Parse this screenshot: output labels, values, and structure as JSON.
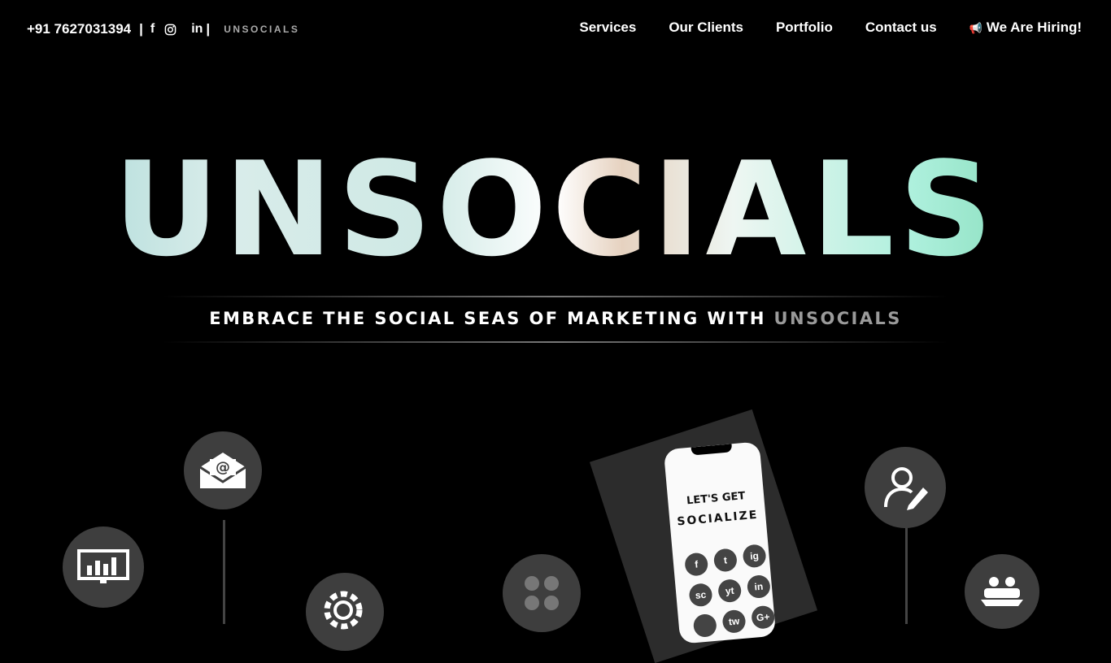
{
  "topbar": {
    "phone": "+91 7627031394",
    "sep": "|",
    "facebook": "f",
    "linkedin": "in",
    "brand": "UNSOCIALS"
  },
  "nav": {
    "items": [
      "Services",
      "Our Clients",
      "Portfolio",
      "Contact us"
    ],
    "hiring_icon": "📢",
    "hiring": "We Are Hiring!"
  },
  "hero": {
    "title": "UNSOCIALS",
    "tagline_main": "EMBRACE THE SOCIAL SEAS OF MARKETING WITH ",
    "tagline_brand": "UNSOCIALS"
  },
  "phone": {
    "line1": "LET'S GET",
    "line2": "SOCIALIZE",
    "icons": [
      "f",
      "t",
      "ig",
      "sc",
      "yt",
      "in",
      "",
      "tw",
      "G+"
    ]
  },
  "illustration": {
    "bulbs": [
      "analytics-icon",
      "email-icon",
      "seo-icon",
      "social-icon",
      "user-edit-icon",
      "handshake-icon"
    ]
  },
  "colors": {
    "background": "#000000",
    "text": "#ffffff",
    "muted": "#9a9a9a"
  }
}
